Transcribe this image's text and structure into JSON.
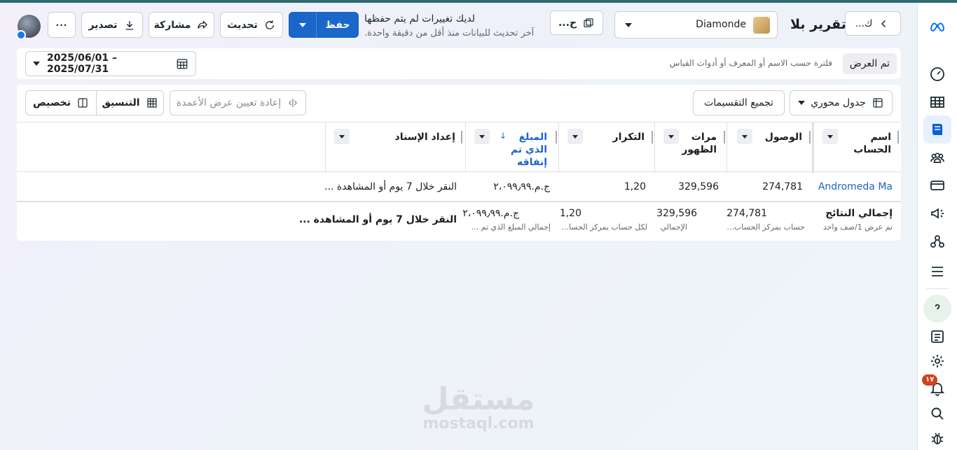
{
  "header": {
    "title": "تقرير بلا",
    "back_label": "ك...",
    "ad_account": "Diamonde",
    "other_button": "ح...",
    "status_title": "لديك تغييرات لم يتم حفظها",
    "status_sub": "آخر تحديث للبيانات منذ أقل من دقيقة واحدة.",
    "save_label": "حفظ",
    "refresh_label": "تحديث",
    "share_label": "مشاركة",
    "export_label": "تصدير",
    "more_label": "···"
  },
  "filters": {
    "view_chip": "تم العرض",
    "placeholder": "فلترة حسب الاسم أو المعرف أو أدوات القياس",
    "date_range": "2025/06/01 – 2025/07/31"
  },
  "toolbar": {
    "pivot_label": "جدول محوري",
    "group_label": "تجميع التقسيمات",
    "reset_columns_label": "إعادة تعيين عرض الأعمدة",
    "format_label": "التنسيق",
    "customize_label": "تخصيص"
  },
  "table": {
    "columns": [
      "اسم الحساب",
      "الوصول",
      "مرات الظهور",
      "التكرار",
      "المبلغ الذي تم إنفاقه",
      "إعداد الإسناد"
    ],
    "row": {
      "account": "Andromeda Ma",
      "reach": "274,781",
      "impressions": "329,596",
      "frequency": "1,20",
      "spend": "ج.م.‏٢،٠٩٩٫٩٩",
      "attribution": "النقر خلال 7 يوم أو المشاهدة ..."
    },
    "totals": {
      "label": "إجمالي النتائج",
      "label_sub": "تم عرض 1/صف واحد",
      "reach": "274,781",
      "reach_sub": "حساب بمركز الحساب...",
      "impressions": "329,596",
      "impressions_sub": "الإجمالي",
      "frequency": "1,20",
      "frequency_sub": "لكل حساب بمركز الحسا...",
      "spend": "ج.م.‏٢،٠٩٩٫٩٩",
      "spend_sub": "إجمالي المبلغ الذي تم ...",
      "attribution": "النقر خلال 7 يوم أو المشاهدة ..."
    }
  },
  "rail": {
    "notification_count": "١٧"
  },
  "watermark": {
    "ar": "مستقل",
    "en": "mostaql.com"
  },
  "colors": {
    "accent": "#1a66c9",
    "badge": "#d0421b",
    "topline": "#2e6b72"
  }
}
